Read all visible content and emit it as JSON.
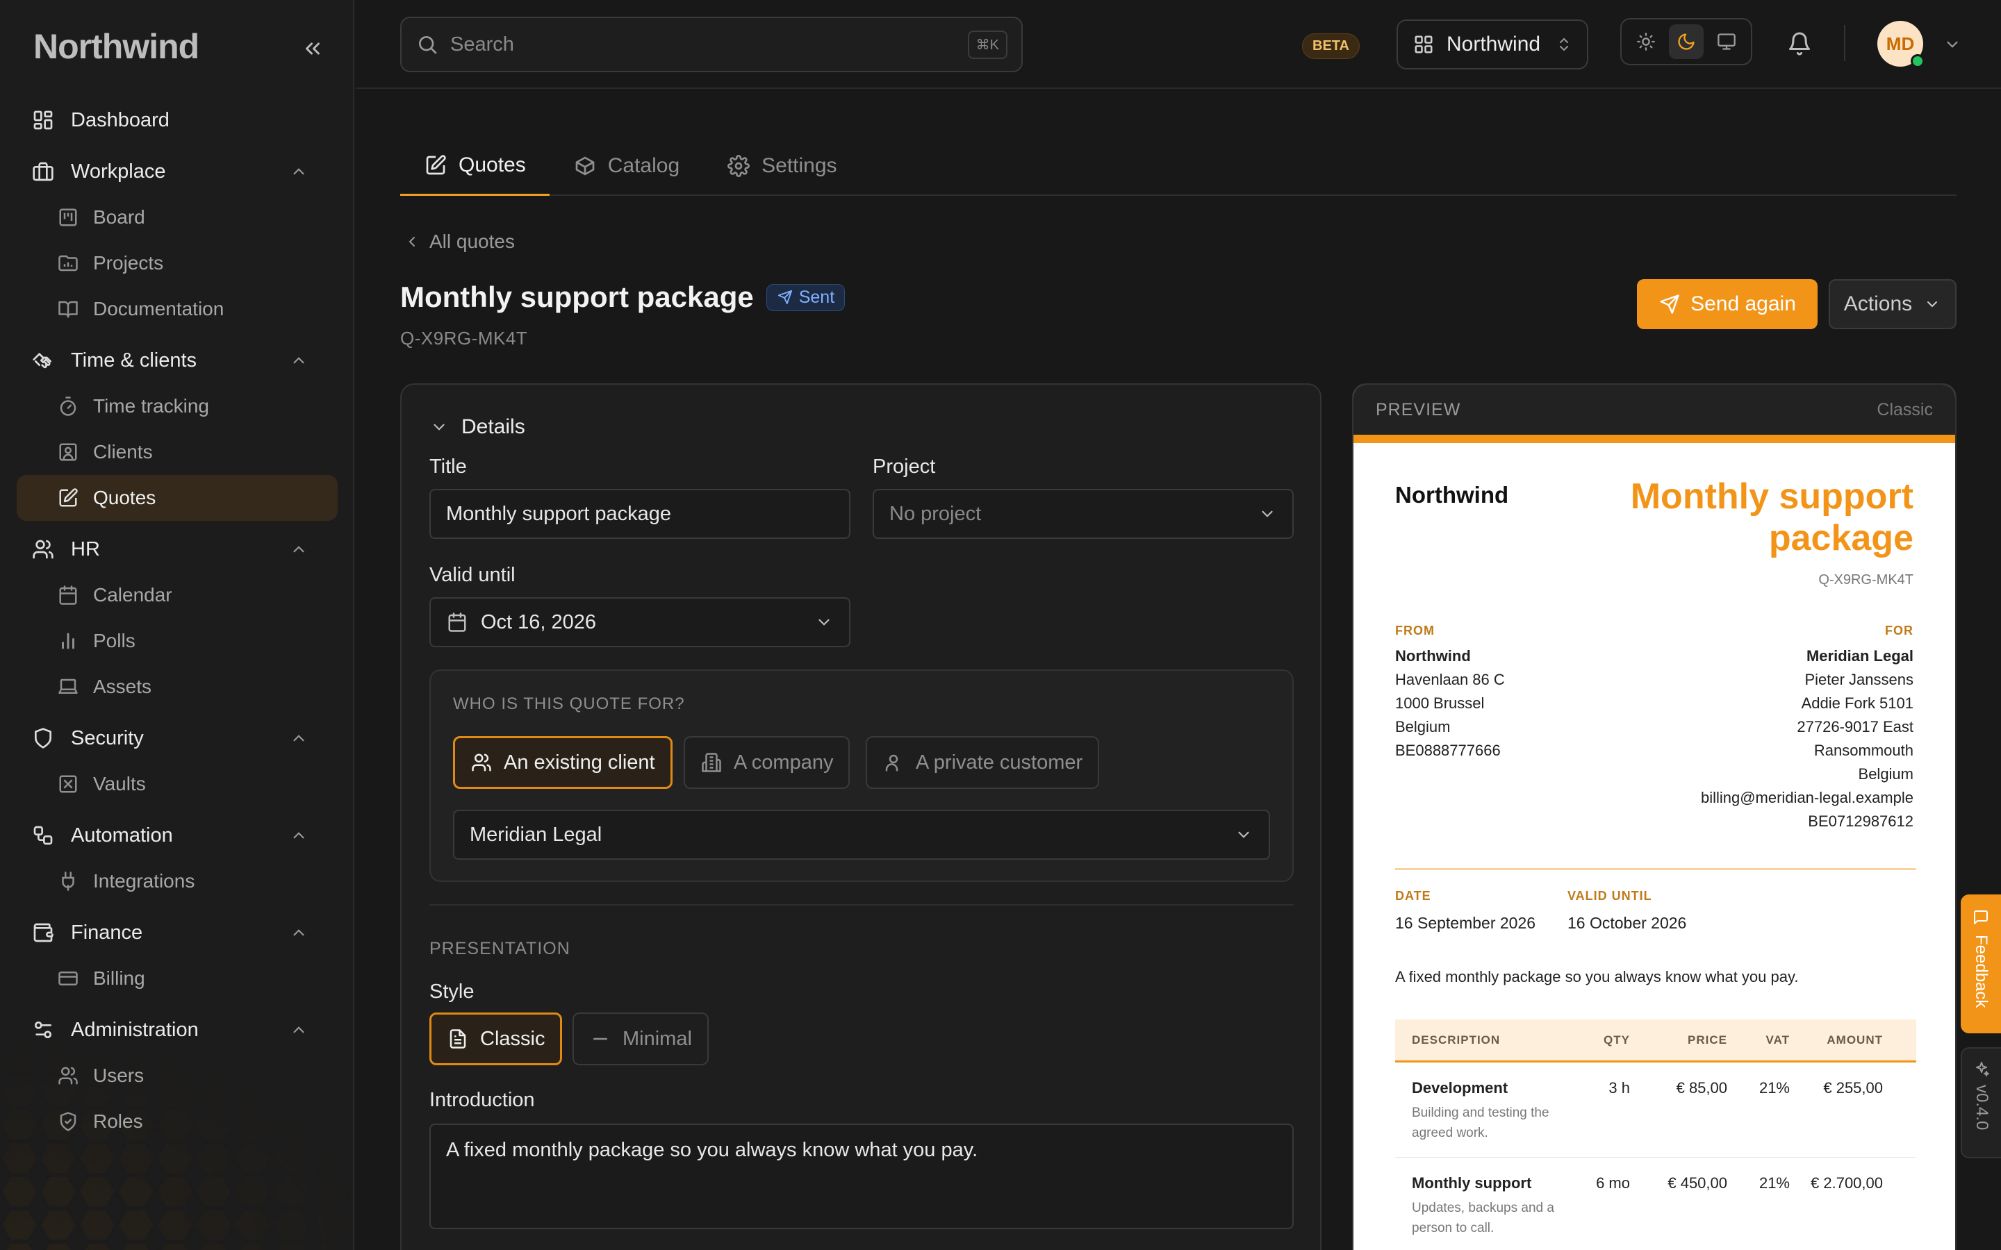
{
  "app": {
    "brand": "Northwind"
  },
  "sidebar": {
    "dashboard": "Dashboard",
    "groups": [
      {
        "label": "Workplace",
        "items": [
          "Board",
          "Projects",
          "Documentation"
        ]
      },
      {
        "label": "Time & clients",
        "items": [
          "Time tracking",
          "Clients",
          "Quotes"
        ]
      },
      {
        "label": "HR",
        "items": [
          "Calendar",
          "Polls",
          "Assets"
        ]
      },
      {
        "label": "Security",
        "items": [
          "Vaults"
        ]
      },
      {
        "label": "Automation",
        "items": [
          "Integrations"
        ]
      },
      {
        "label": "Finance",
        "items": [
          "Billing"
        ]
      },
      {
        "label": "Administration",
        "items": [
          "Users",
          "Roles"
        ]
      }
    ],
    "active_item": "Quotes"
  },
  "topbar": {
    "search_placeholder": "Search",
    "search_shortcut": "⌘K",
    "beta": "BETA",
    "workspace": "Northwind",
    "theme_selected": "dark",
    "avatar_initials": "MD",
    "presence_color": "#23c55e"
  },
  "tabs": [
    {
      "label": "Quotes",
      "active": true
    },
    {
      "label": "Catalog",
      "active": false
    },
    {
      "label": "Settings",
      "active": false
    }
  ],
  "header": {
    "back": "All quotes",
    "title": "Monthly support package",
    "status": "Sent",
    "code": "Q-X9RG-MK4T",
    "send_again": "Send again",
    "actions": "Actions"
  },
  "form": {
    "section": "Details",
    "title_label": "Title",
    "title_value": "Monthly support package",
    "project_label": "Project",
    "project_value": "No project",
    "valid_until_label": "Valid until",
    "valid_until_value": "Oct 16, 2026",
    "who_title": "WHO IS THIS QUOTE FOR?",
    "who_options": [
      "An existing client",
      "A company",
      "A private customer"
    ],
    "who_selected": "An existing client",
    "client_value": "Meridian Legal",
    "presentation": "PRESENTATION",
    "style_label": "Style",
    "style_options": [
      "Classic",
      "Minimal"
    ],
    "style_selected": "Classic",
    "intro_label": "Introduction",
    "intro_value": "A fixed monthly package so you always know what you pay."
  },
  "preview": {
    "label": "PREVIEW",
    "style": "Classic",
    "brand": "Northwind",
    "title": "Monthly support package",
    "code": "Q-X9RG-MK4T",
    "from_label": "FROM",
    "from": [
      "Northwind",
      "Havenlaan 86 C",
      "1000 Brussel",
      "Belgium",
      "BE0888777666"
    ],
    "for_label": "FOR",
    "for": [
      "Meridian Legal",
      "Pieter Janssens",
      "Addie Fork 5101",
      "27726-9017 East",
      "Ransommouth",
      "Belgium",
      "billing@meridian-legal.example",
      "BE0712987612"
    ],
    "date_label": "DATE",
    "date": "16 September 2026",
    "valid_label": "VALID UNTIL",
    "valid": "16 October 2026",
    "intro": "A fixed monthly package so you always know what you pay.",
    "columns": [
      "DESCRIPTION",
      "QTY",
      "PRICE",
      "VAT",
      "AMOUNT"
    ],
    "rows": [
      {
        "name": "Development",
        "desc": "Building and testing the agreed work.",
        "qty": "3 h",
        "price": "€ 85,00",
        "vat": "21%",
        "amount": "€ 255,00"
      },
      {
        "name": "Monthly support",
        "desc": "Updates, backups and a person to call.",
        "qty": "6 mo",
        "price": "€ 450,00",
        "vat": "21%",
        "amount": "€ 2.700,00"
      }
    ],
    "accent": "#f29418"
  },
  "side": {
    "feedback": "Feedback",
    "version": "v0.4.0"
  }
}
